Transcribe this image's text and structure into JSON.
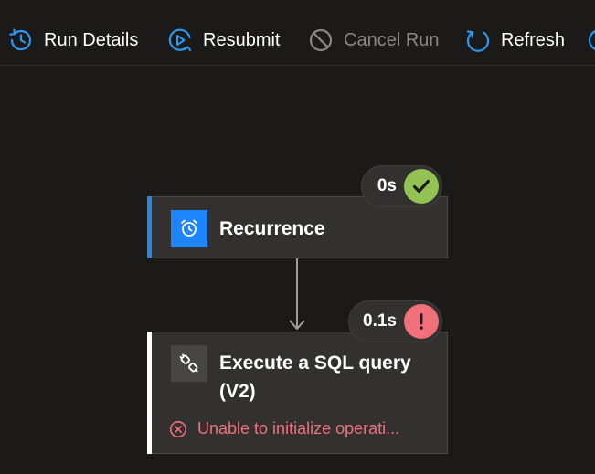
{
  "toolbar": {
    "run_details": "Run Details",
    "resubmit": "Resubmit",
    "cancel_run": "Cancel Run",
    "refresh": "Refresh"
  },
  "actions": [
    {
      "title": "Recurrence",
      "duration": "0s",
      "status": "succeeded"
    },
    {
      "title": "Execute a SQL query (V2)",
      "duration": "0.1s",
      "status": "failed",
      "error": "Unable to initialize operati..."
    }
  ],
  "colors": {
    "background": "#1b1a19",
    "card": "#323130",
    "accent_blue": "#2b88d8",
    "icon_blue": "#1f85ff",
    "success": "#92c353",
    "error": "#f1707b",
    "disabled_text": "#8a8886"
  },
  "icons": {
    "run_details": "history-icon",
    "resubmit": "play-resubmit-icon",
    "cancel_run": "cancel-icon",
    "refresh": "refresh-icon",
    "recurrence": "alarm-clock-icon",
    "sql": "plug-connection-icon",
    "succeeded": "checkmark-icon",
    "failed": "exclamation-icon",
    "error": "error-circle-icon"
  }
}
